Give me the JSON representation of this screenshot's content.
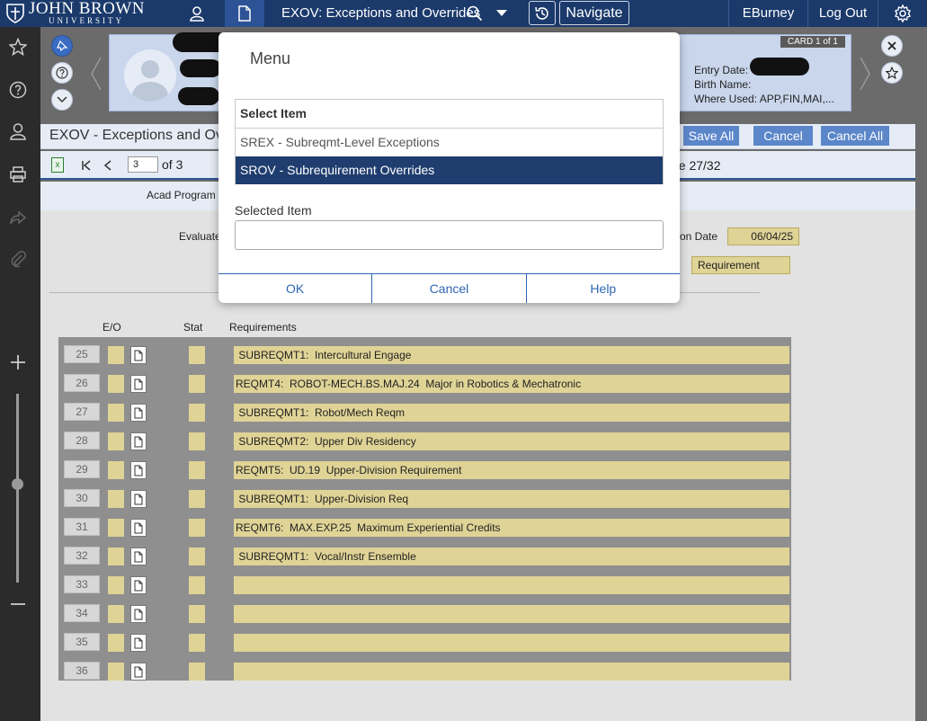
{
  "topbar": {
    "logo_line1": "JOHN BROWN",
    "logo_line2": "UNIVERSITY",
    "form_title": "EXOV: Exceptions and Overrides",
    "navigate_label": "Navigate",
    "user_label": "EBurney",
    "logout_label": "Log Out"
  },
  "card": {
    "label": "CARD 1 of 1",
    "entry_date_label": "Entry Date:",
    "birth_name_label": "Birth Name:",
    "where_used_label": "Where Used: APP,FIN,MAI,..."
  },
  "form": {
    "title": "EXOV - Exceptions and Ov",
    "save_all": "Save All",
    "cancel": "Cancel",
    "cancel_all": "Cancel All",
    "record_value": "3",
    "record_of": "of 3",
    "issue": "ue 27/32",
    "acad_program_label": "Acad Program",
    "evaluate_label": "Evaluate",
    "date_label": "on Date",
    "date_value": "06/04/25",
    "type_value": "Requirement"
  },
  "grid": {
    "col_eo": "E/O",
    "col_stat": "Stat",
    "col_requirements": "Requirements",
    "rows": [
      {
        "num": "25",
        "req": " SUBREQMT1:  Intercultural Engage"
      },
      {
        "num": "26",
        "req": "REQMT4:  ROBOT-MECH.BS.MAJ.24  Major in Robotics & Mechatronic"
      },
      {
        "num": "27",
        "req": " SUBREQMT1:  Robot/Mech Reqm"
      },
      {
        "num": "28",
        "req": " SUBREQMT2:  Upper Div Residency"
      },
      {
        "num": "29",
        "req": "REQMT5:  UD.19  Upper-Division Requirement"
      },
      {
        "num": "30",
        "req": " SUBREQMT1:  Upper-Division Req"
      },
      {
        "num": "31",
        "req": "REQMT6:  MAX.EXP.25  Maximum Experiential Credits"
      },
      {
        "num": "32",
        "req": " SUBREQMT1:  Vocal/Instr Ensemble"
      },
      {
        "num": "33",
        "req": ""
      },
      {
        "num": "34",
        "req": ""
      },
      {
        "num": "35",
        "req": ""
      },
      {
        "num": "36",
        "req": ""
      }
    ]
  },
  "modal": {
    "title": "Menu",
    "list_header": "Select Item",
    "items": [
      {
        "label": "SREX - Subreqmt-Level Exceptions"
      },
      {
        "label": "SROV - Subrequirement Overrides"
      }
    ],
    "selected_item_label": "Selected Item",
    "selected_item_value": "",
    "ok": "OK",
    "cancel": "Cancel",
    "help": "Help"
  }
}
